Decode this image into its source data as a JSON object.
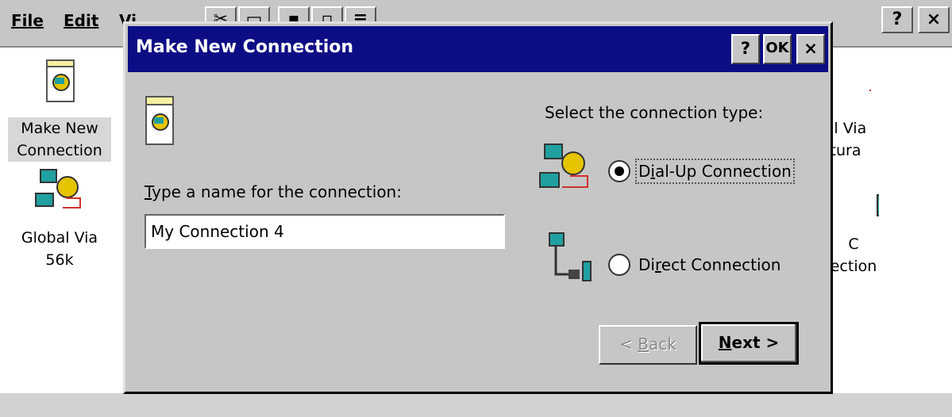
{
  "menubar": {
    "file": "File",
    "edit": "Edit",
    "view": "Vi"
  },
  "toolbar": {
    "cut_icon": "scissors-icon",
    "copy_icon": "copy-icon",
    "large_icons": "large-icons-view",
    "small_icons": "small-icons-view",
    "details": "details-view"
  },
  "window_controls": {
    "help": "?",
    "close": "×"
  },
  "desktop_icons": [
    {
      "line1": "Make New",
      "line2": "Connection",
      "icon": "make-new-connection-icon"
    },
    {
      "line1": "Global Via",
      "line2": "56k",
      "icon": "dialup-connection-icon"
    },
    {
      "line1": "al Via",
      "line2": "tura",
      "icon": "dialup-connection-icon"
    },
    {
      "line1": "C",
      "line2": "ection",
      "icon": "direct-connection-icon"
    }
  ],
  "dialog": {
    "title": "Make New Connection",
    "help_btn": "?",
    "ok_btn": "OK",
    "close_btn": "×",
    "name_label_prefix": "T",
    "name_label_rest": "ype a name for the connection:",
    "name_value": "My Connection 4",
    "type_label": "Select the connection type:",
    "options": [
      {
        "pre": "D",
        "acc": "i",
        "post": "al-Up Connection",
        "checked": true
      },
      {
        "pre": "Di",
        "acc": "r",
        "post": "ect Connection",
        "checked": false
      }
    ],
    "back_btn_pre": "< ",
    "back_btn_acc": "B",
    "back_btn_post": "ack",
    "next_btn_acc": "N",
    "next_btn_post": "ext >"
  }
}
